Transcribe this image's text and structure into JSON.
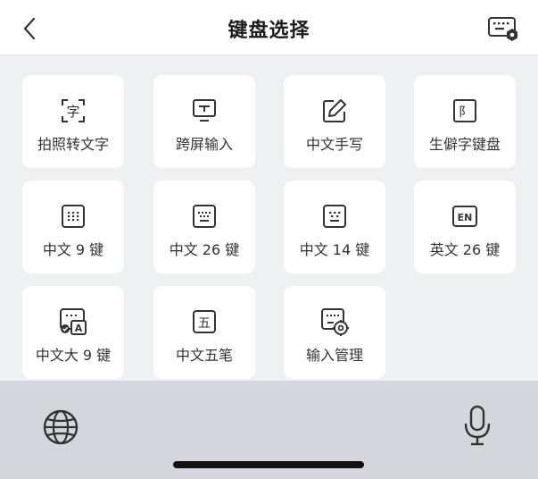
{
  "header": {
    "title": "键盘选择",
    "back_icon": "chevron-left-icon",
    "settings_icon": "keyboard-settings-icon"
  },
  "tiles": [
    {
      "label": "拍照转文字",
      "icon": "photo-to-text-icon",
      "glyph": "字"
    },
    {
      "label": "跨屏输入",
      "icon": "cross-screen-input-icon"
    },
    {
      "label": "中文手写",
      "icon": "handwriting-icon"
    },
    {
      "label": "生僻字键盘",
      "icon": "rare-character-icon",
      "glyph": "阝"
    },
    {
      "label": "中文 9 键",
      "icon": "keypad-9-icon"
    },
    {
      "label": "中文 26 键",
      "icon": "keyboard-26-icon"
    },
    {
      "label": "中文 14 键",
      "icon": "keyboard-14-icon"
    },
    {
      "label": "英文 26 键",
      "icon": "english-keyboard-icon",
      "glyph": "EN"
    },
    {
      "label": "中文大 9 键",
      "icon": "large-keypad-9-icon",
      "glyph": "A"
    },
    {
      "label": "中文五笔",
      "icon": "wubi-icon",
      "glyph": "五"
    },
    {
      "label": "输入管理",
      "icon": "input-management-icon"
    }
  ],
  "bottom_bar": {
    "globe_icon": "globe-icon",
    "mic_icon": "microphone-icon"
  },
  "colors": {
    "page_bg": "#eff0f2",
    "tile_bg": "#ffffff",
    "bottom_bar_bg": "#d4d6db",
    "icon_stroke": "#333333"
  }
}
